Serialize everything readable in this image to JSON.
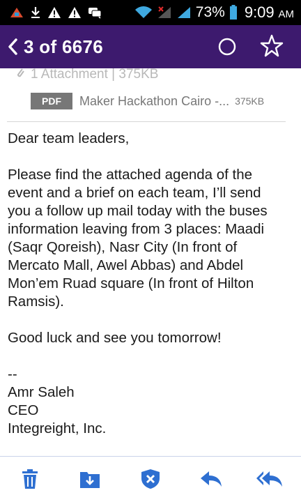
{
  "status_bar": {
    "battery_percent": "73%",
    "time": "9:09",
    "ampm": "AM",
    "icons": [
      "app-icon",
      "download-icon",
      "alert-icon",
      "alert-icon",
      "chat-icon",
      "wifi-icon",
      "signal-off-icon",
      "signal-icon",
      "battery-icon"
    ]
  },
  "nav": {
    "counter": "3 of 6676",
    "icons": [
      "chevron-left-icon",
      "circle-icon",
      "star-icon"
    ]
  },
  "attachment": {
    "header": "1 Attachment | 375KB",
    "badge": "PDF",
    "name": "Maker Hackathon Cairo -...",
    "size": "375KB"
  },
  "email": {
    "greeting": "Dear team leaders,",
    "body_lines": [
      "Please find the attached agenda of the",
      "event and a brief on each team, I’ll send",
      "you a follow up mail today with the buses",
      "information leaving from 3 places: Maadi",
      "(Saqr Qoreish), Nasr City (In front of",
      "Mercato Mall, Awel Abbas) and Abdel",
      "Mon’em Ruad square (In front of Hilton",
      "Ramsis)."
    ],
    "closing": "Good luck and see you tomorrow!",
    "sig_separator": "--",
    "sig_name": "Amr Saleh",
    "sig_title": "CEO",
    "sig_company": "Integreight, Inc."
  },
  "colors": {
    "nav_bg": "#3d1a6e",
    "toolbar_icon": "#2e6fd1"
  },
  "toolbar": {
    "icons": [
      "trash-icon",
      "archive-icon",
      "spam-icon",
      "reply-icon",
      "reply-all-icon"
    ]
  }
}
